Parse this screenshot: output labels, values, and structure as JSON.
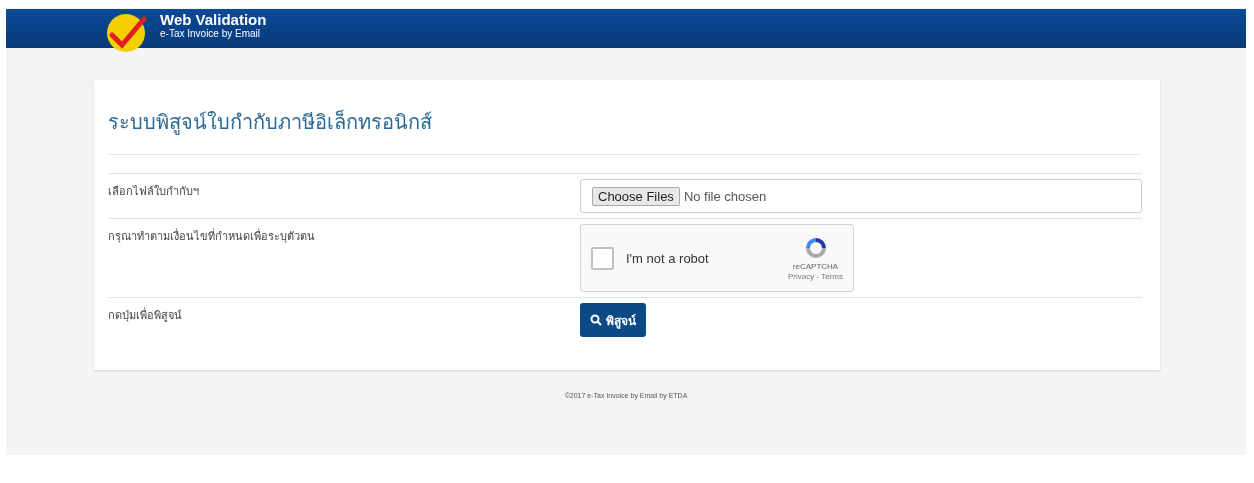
{
  "header": {
    "title": "Web Validation",
    "subtitle": "e-Tax Invoice by Email"
  },
  "form": {
    "title": "ระบบพิสูจน์ใบกำกับภาษีอิเล็กทรอนิกส์",
    "rows": [
      {
        "kind": "file",
        "label": "เลือกไฟล์ใบกำกับฯ",
        "button": "Choose Files",
        "status": "No file chosen"
      },
      {
        "kind": "captcha",
        "label": "กรุณาทำตามเงื่อนไขที่กำหนดเพื่อระบุตัวตน",
        "text": "I'm not a robot",
        "checked": false,
        "brand": "reCAPTCHA",
        "links": "Privacy - Terms"
      },
      {
        "kind": "submit",
        "label": "กดปุ่มเพื่อพิสูจน์",
        "button": "พิสูจน์"
      }
    ]
  },
  "footer": "©2017 e-Tax Invoice by Email by ETDA"
}
